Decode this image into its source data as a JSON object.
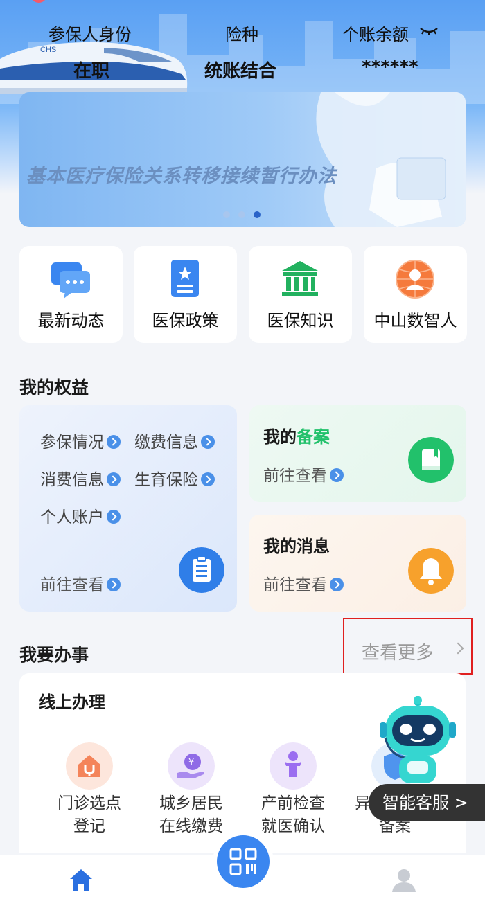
{
  "header": {
    "labels": [
      "参保人身份",
      "险种",
      "个账余额"
    ],
    "values": [
      "在职",
      "统账结合",
      "******"
    ],
    "eye_icon": "eye-closed-icon"
  },
  "banner": {
    "text": "基本医疗保险关系转移接续暂行办法",
    "dots_total": 3,
    "active_dot_index": 2
  },
  "quick_links": [
    {
      "label": "最新动态",
      "icon": "chat-bubbles-icon"
    },
    {
      "label": "医保政策",
      "icon": "policy-document-icon"
    },
    {
      "label": "医保知识",
      "icon": "bank-building-icon"
    },
    {
      "label": "中山数智人",
      "icon": "digital-person-icon"
    }
  ],
  "rights": {
    "title": "我的权益",
    "links": [
      "参保情况",
      "缴费信息",
      "消费信息",
      "生育保险",
      "个人账户"
    ],
    "go_label": "前往查看",
    "filing": {
      "title_prefix": "我的",
      "title_highlight": "备案",
      "go_label": "前往查看"
    },
    "messages": {
      "title": "我的消息",
      "go_label": "前往查看"
    }
  },
  "tasks": {
    "title": "我要办事",
    "more_label": "查看更多",
    "online_title": "线上办理",
    "services": [
      {
        "line1": "门诊选点",
        "line2": "登记"
      },
      {
        "line1": "城乡居民",
        "line2": "在线缴费"
      },
      {
        "line1": "产前检查",
        "line2": "就医确认"
      },
      {
        "line1": "异",
        "line2": "备案"
      }
    ]
  },
  "customer_service": {
    "label": "智能客服 >"
  },
  "colors": {
    "primary": "#3a86f0",
    "green": "#22c16b",
    "orange": "#f7a12c",
    "highlight_red": "#e02020"
  }
}
